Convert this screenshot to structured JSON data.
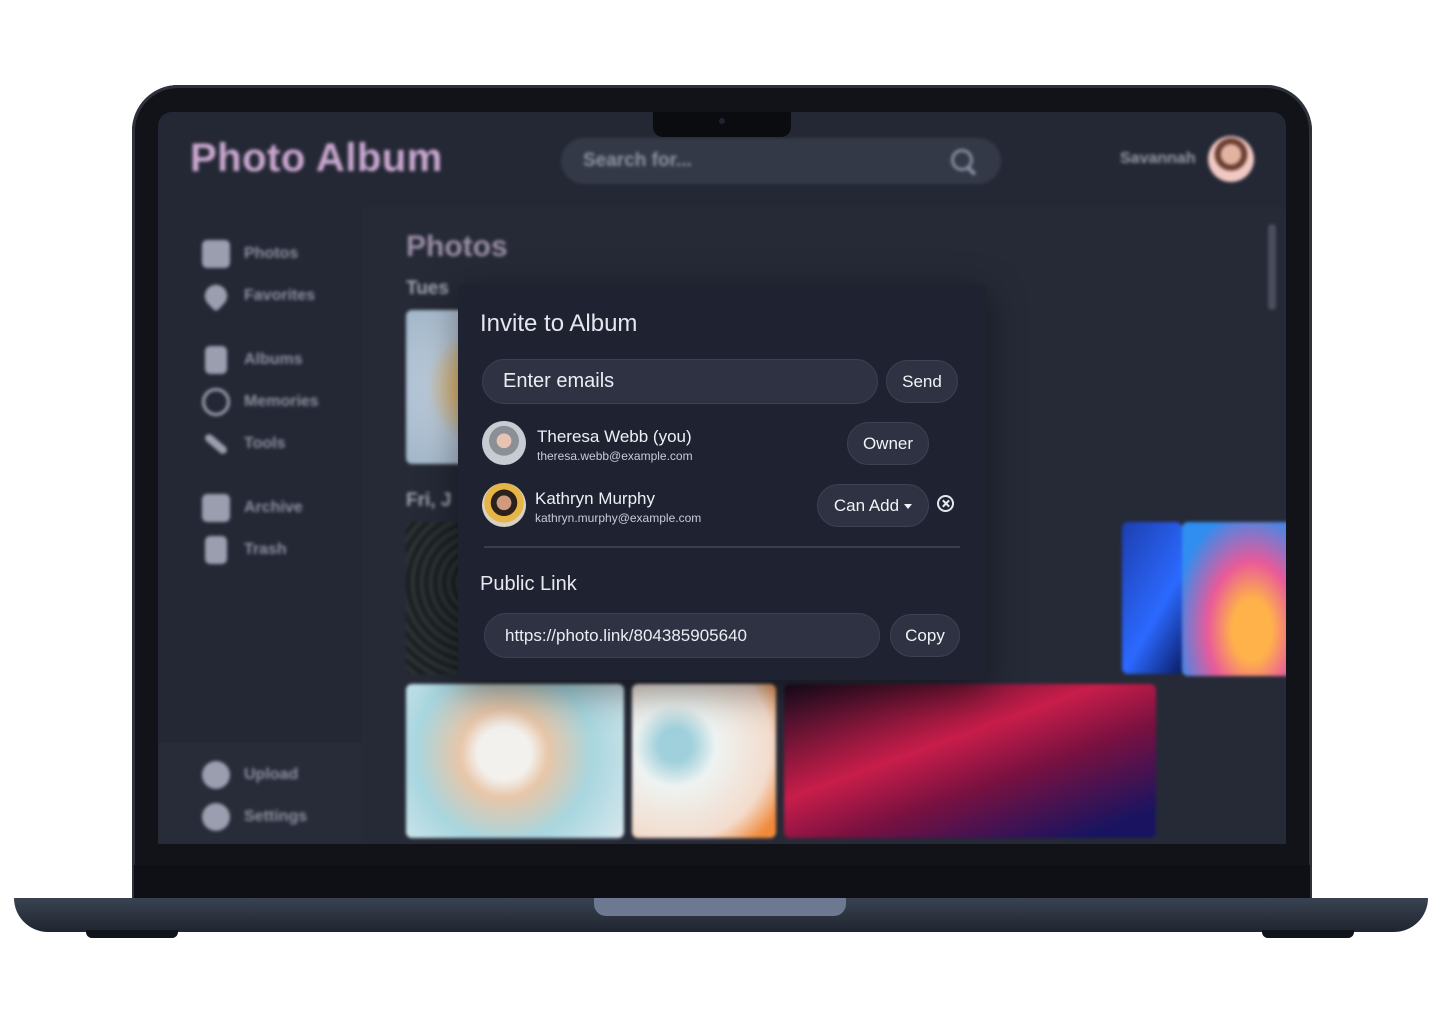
{
  "app": {
    "title": "Photo Album",
    "search_placeholder": "Search for...",
    "username": "Savannah"
  },
  "sidebar": {
    "items": [
      {
        "label": "Photos",
        "icon": "photos-icon"
      },
      {
        "label": "Favorites",
        "icon": "heart-icon"
      },
      {
        "label": "Albums",
        "icon": "album-icon"
      },
      {
        "label": "Memories",
        "icon": "memories-icon"
      },
      {
        "label": "Tools",
        "icon": "wrench-icon"
      },
      {
        "label": "Archive",
        "icon": "archive-icon"
      },
      {
        "label": "Trash",
        "icon": "trash-icon"
      }
    ],
    "bottom_items": [
      {
        "label": "Upload",
        "icon": "plus-circle-icon"
      },
      {
        "label": "Settings",
        "icon": "gear-icon"
      }
    ]
  },
  "main": {
    "section_title": "Photos",
    "date_groups": [
      "Tues",
      "Fri, J"
    ]
  },
  "modal": {
    "title": "Invite to Album",
    "email_placeholder": "Enter emails",
    "send_label": "Send",
    "members": [
      {
        "name": "Theresa Webb (you)",
        "email": "theresa.webb@example.com",
        "role": "Owner"
      },
      {
        "name": "Kathryn Murphy",
        "email": "kathryn.murphy@example.com",
        "role": "Can Add"
      }
    ],
    "public_link_label": "Public Link",
    "public_link": "https://photo.link/804385905640",
    "copy_label": "Copy"
  },
  "colors": {
    "brand_title": "#c9a7cf",
    "background": "#262a37",
    "modal": "#1f2231"
  }
}
